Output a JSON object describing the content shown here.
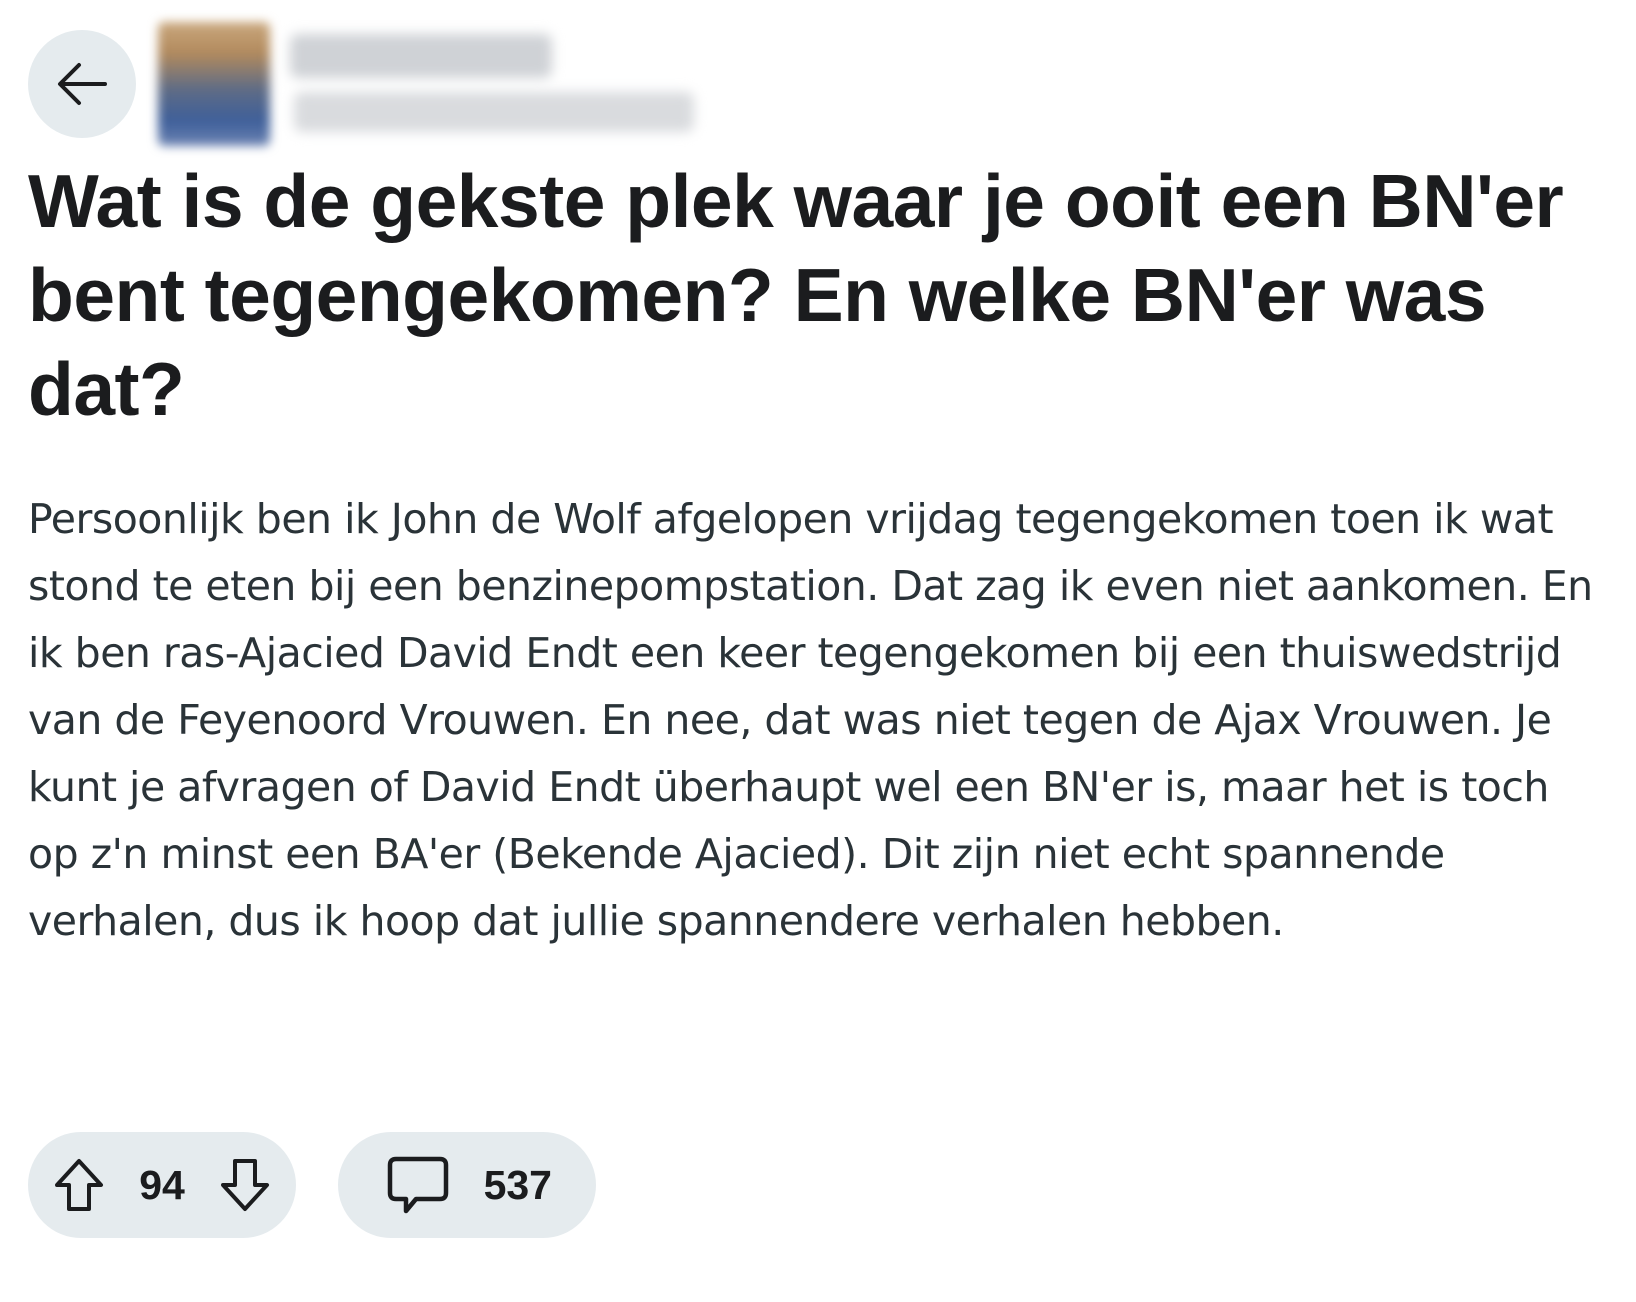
{
  "header": {
    "back_icon": "arrow-left-icon",
    "avatar_icon": "user-avatar"
  },
  "post": {
    "title": "Wat is de gekste plek waar je ooit een BN'er bent tegengekomen? En welke BN'er was dat?",
    "body": "Persoonlijk ben ik John de Wolf afgelopen vrijdag tegengekomen toen ik wat stond te eten bij een benzinepompstation. Dat zag ik even niet aankomen. En ik ben ras-Ajacied David Endt een keer tegengekomen bij een thuiswedstrijd van de Feyenoord Vrouwen. En nee, dat was niet tegen de Ajax Vrouwen. Je kunt je afvragen of David Endt überhaupt wel een BN'er is, maar het is toch op z'n minst een BA'er (Bekende Ajacied). Dit zijn niet echt spannende verhalen, dus ik hoop dat jullie spannendere verhalen hebben."
  },
  "actions": {
    "vote_count": "94",
    "comment_count": "537",
    "upvote_icon": "arrow-up-icon",
    "downvote_icon": "arrow-down-icon",
    "comment_icon": "speech-bubble-icon"
  },
  "colors": {
    "pill_background": "#e5ebee",
    "title_text": "#1b1c1e",
    "body_text": "#2a3338"
  }
}
